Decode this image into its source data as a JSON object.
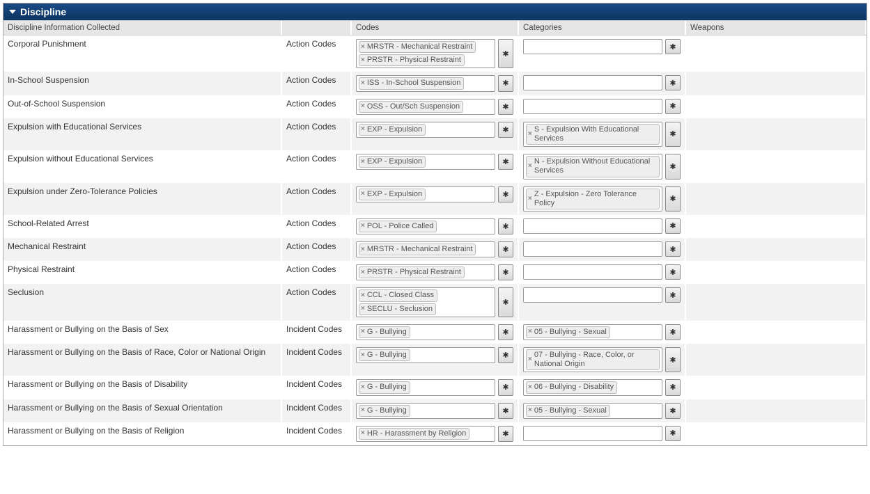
{
  "panel": {
    "title": "Discipline"
  },
  "headers": {
    "info": "Discipline Information Collected",
    "codes": "Codes",
    "categories": "Categories",
    "weapons": "Weapons"
  },
  "typeLabels": {
    "action": "Action Codes",
    "incident": "Incident Codes"
  },
  "rows": [
    {
      "info": "Corporal Punishment",
      "type": "action",
      "codes": [
        "MRSTR - Mechanical Restraint",
        "PRSTR - Physical Restraint"
      ],
      "categories": []
    },
    {
      "info": "In-School Suspension",
      "type": "action",
      "codes": [
        "ISS - In-School Suspension"
      ],
      "categories": []
    },
    {
      "info": "Out-of-School Suspension",
      "type": "action",
      "codes": [
        "OSS - Out/Sch Suspension"
      ],
      "categories": []
    },
    {
      "info": "Expulsion with Educational Services",
      "type": "action",
      "codes": [
        "EXP - Expulsion"
      ],
      "categories": [
        "S - Expulsion With Educational Services"
      ]
    },
    {
      "info": "Expulsion without Educational Services",
      "type": "action",
      "codes": [
        "EXP - Expulsion"
      ],
      "categories": [
        "N - Expulsion Without Educational Services"
      ]
    },
    {
      "info": "Expulsion under Zero-Tolerance Policies",
      "type": "action",
      "codes": [
        "EXP - Expulsion"
      ],
      "categories": [
        "Z - Expulsion - Zero Tolerance Policy"
      ]
    },
    {
      "info": "School-Related Arrest",
      "type": "action",
      "codes": [
        "POL - Police Called"
      ],
      "categories": []
    },
    {
      "info": "Mechanical Restraint",
      "type": "action",
      "codes": [
        "MRSTR - Mechanical Restraint"
      ],
      "categories": []
    },
    {
      "info": "Physical Restraint",
      "type": "action",
      "codes": [
        "PRSTR - Physical Restraint"
      ],
      "categories": []
    },
    {
      "info": "Seclusion",
      "type": "action",
      "codes": [
        "CCL - Closed Class",
        "SECLU - Seclusion"
      ],
      "categories": []
    },
    {
      "info": "Harassment or Bullying on the Basis of Sex",
      "type": "incident",
      "codes": [
        "G - Bullying"
      ],
      "categories": [
        "05 - Bullying - Sexual"
      ]
    },
    {
      "info": "Harassment or Bullying on the Basis of Race, Color or National Origin",
      "type": "incident",
      "codes": [
        "G - Bullying"
      ],
      "categories": [
        "07 - Bullying - Race, Color, or National Origin"
      ]
    },
    {
      "info": "Harassment or Bullying on the Basis of Disability",
      "type": "incident",
      "codes": [
        "G - Bullying"
      ],
      "categories": [
        "06 - Bullying - Disability"
      ]
    },
    {
      "info": "Harassment or Bullying on the Basis of Sexual Orientation",
      "type": "incident",
      "codes": [
        "G - Bullying"
      ],
      "categories": [
        "05 - Bullying - Sexual"
      ]
    },
    {
      "info": "Harassment or Bullying on the Basis of Religion",
      "type": "incident",
      "codes": [
        "HR - Harassment by Religion"
      ],
      "categories": []
    }
  ]
}
